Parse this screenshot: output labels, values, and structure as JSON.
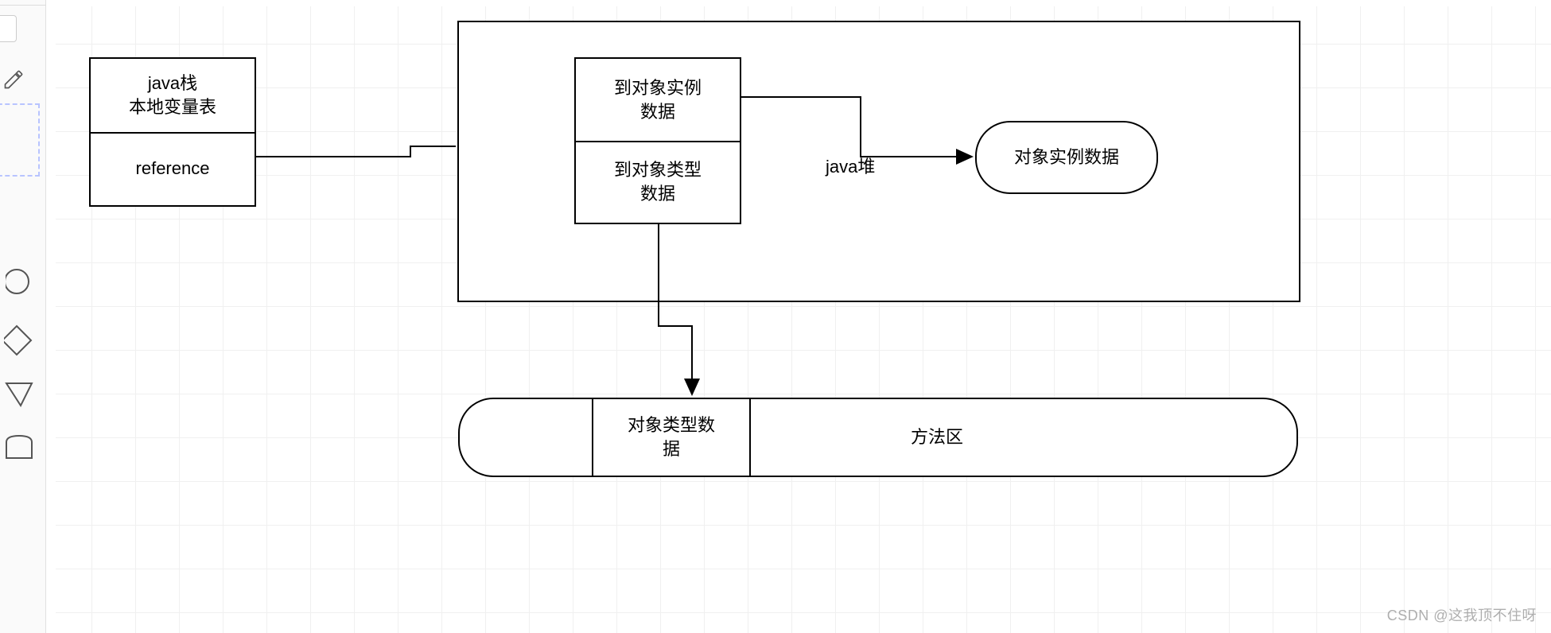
{
  "stack_box": {
    "line1": "java栈",
    "line2": "本地变量表",
    "line3": "reference"
  },
  "heap_container_label": "java堆",
  "handle_box": {
    "top": "到对象实例",
    "top2": "数据",
    "bottom": "到对象类型",
    "bottom2": "数据"
  },
  "instance_box": "对象实例数据",
  "method_area": {
    "cell": "对象类型数",
    "cell2": "据",
    "label": "方法区"
  },
  "watermark": "CSDN @这我顶不住呀"
}
